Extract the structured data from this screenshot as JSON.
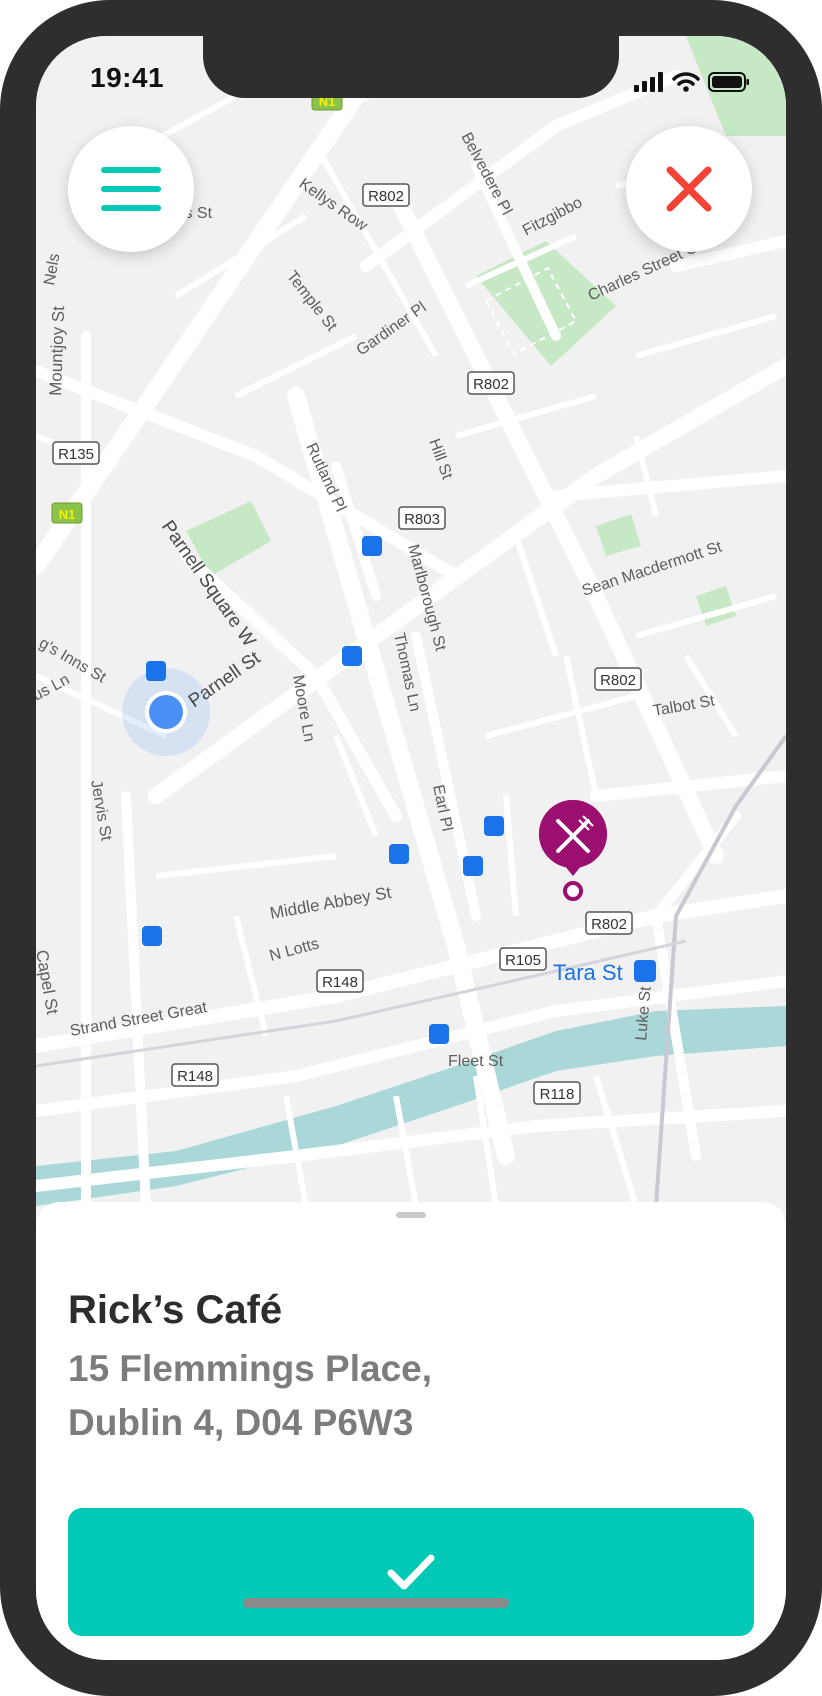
{
  "status_bar": {
    "time": "19:41"
  },
  "map": {
    "labels": {
      "street_kellys_row": "Kellys Row",
      "street_belvedere_pl": "Belvedere Pl",
      "street_fitzgibbon": "Fitzgibbo",
      "street_charles_st": "Charles Street Great",
      "street_temple_st": "Temple St",
      "street_gardiner_pl": "Gardiner Pl",
      "street_les_st": "les St",
      "street_nels": "Nels",
      "street_mountjoy": "Mountjoy St",
      "street_parnell_sq": "Parnell Square W",
      "street_parnell_st": "Parnell St",
      "street_rutland_pl": "Rutland Pl",
      "street_hill_st": "Hill St",
      "street_marlborough": "Marlborough St",
      "street_thomas_ln": "Thomas Ln",
      "street_moore_ln": "Moore Ln",
      "street_sean_mac": "Sean Macdermott St",
      "street_talbot": "Talbot St",
      "street_kings_inns": "g's Inns St",
      "street_us_ln": "us Ln",
      "street_jervis": "Jervis St",
      "street_earl_pl": "Earl Pl",
      "street_middle_abbey": "Middle Abbey St",
      "street_n_lotts": "N Lotts",
      "street_strand": "Strand Street Great",
      "street_capel": "Capel St",
      "street_fleet": "Fleet St",
      "street_luke": "Luke St",
      "place_tara_st": "Tara St",
      "road_n1": "N1",
      "road_r802": "R802",
      "road_r135": "R135",
      "road_r803": "R803",
      "road_r105": "R105",
      "road_r148": "R148",
      "road_r118": "R118"
    },
    "destination_icon": "restaurant-pin-icon",
    "user_icon": "current-location-dot"
  },
  "buttons": {
    "menu_icon": "hamburger-menu-icon",
    "close_icon": "close-x-icon",
    "confirm_icon": "checkmark-icon"
  },
  "place": {
    "name": "Rick’s Café",
    "address_line1": "15 Flemmings Place,",
    "address_line2": "Dublin 4, D04 P6W3"
  },
  "colors": {
    "accent": "#02c9b5",
    "close": "#f44336",
    "pin": "#9a0f6f",
    "user_dot": "#4a90f5",
    "water": "#aad8d8",
    "park": "#c6e8c4"
  }
}
